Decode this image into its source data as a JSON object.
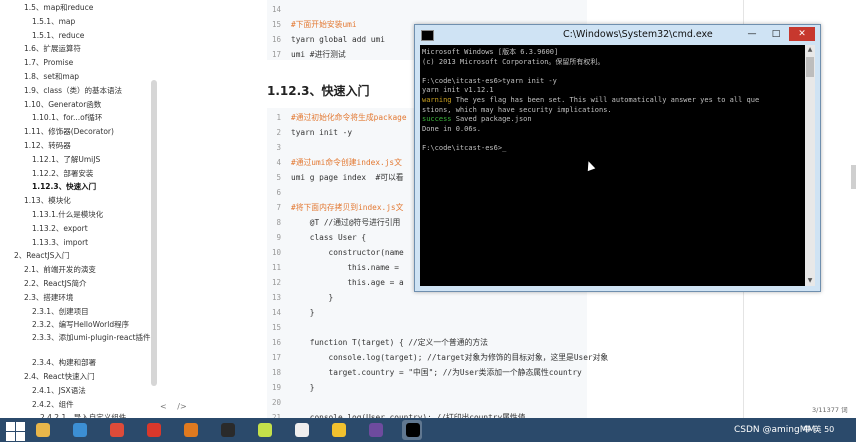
{
  "toc": {
    "items": [
      {
        "label": "1.5、map和reduce",
        "indent": 1
      },
      {
        "label": "1.5.1、map",
        "indent": 2
      },
      {
        "label": "1.5.1、reduce",
        "indent": 2
      },
      {
        "label": "1.6、扩展运算符",
        "indent": 1
      },
      {
        "label": "1.7、Promise",
        "indent": 1
      },
      {
        "label": "1.8、set和map",
        "indent": 1
      },
      {
        "label": "1.9、class（类）的基本语法",
        "indent": 1
      },
      {
        "label": "1.10、Generator函数",
        "indent": 1
      },
      {
        "label": "1.10.1、for...of循环",
        "indent": 2
      },
      {
        "label": "1.11、修饰器(Decorator)",
        "indent": 1
      },
      {
        "label": "1.12、转码器",
        "indent": 1
      },
      {
        "label": "1.12.1、了解UmiJS",
        "indent": 2
      },
      {
        "label": "1.12.2、部署安装",
        "indent": 2
      },
      {
        "label": "1.12.3、快速入门",
        "indent": 2,
        "active": true
      },
      {
        "label": "1.13、模块化",
        "indent": 1
      },
      {
        "label": "1.13.1.什么是模块化",
        "indent": 2
      },
      {
        "label": "1.13.2、export",
        "indent": 2
      },
      {
        "label": "1.13.3、import",
        "indent": 2
      },
      {
        "label": "2、ReactJS入门",
        "indent": 0
      },
      {
        "label": "2.1、前端开发的演变",
        "indent": 1
      },
      {
        "label": "2.2、ReactJS简介",
        "indent": 1
      },
      {
        "label": "2.3、搭建环境",
        "indent": 1
      },
      {
        "label": "2.3.1、创建项目",
        "indent": 2
      },
      {
        "label": "2.3.2、编写HelloWorld程序",
        "indent": 2
      },
      {
        "label": "2.3.3、添加umi-plugin-react插件",
        "indent": 2,
        "wrap": true
      },
      {
        "label": "2.3.4、构建和部署",
        "indent": 2
      },
      {
        "label": "2.4、React快速入门",
        "indent": 1
      },
      {
        "label": "2.4.1、JSX语法",
        "indent": 2
      },
      {
        "label": "2.4.2、组件",
        "indent": 2
      },
      {
        "label": "2.4.2.1、导入自定义组件",
        "indent": 3
      }
    ],
    "bottom_icons": [
      "<",
      "/>"
    ]
  },
  "doc": {
    "heading": "1.12.3、快速入门",
    "block1": [
      {
        "n": "14",
        "text": ""
      },
      {
        "n": "15",
        "text": "#下面开始安装umi",
        "cls": "c"
      },
      {
        "n": "16",
        "text": "tyarn global add umi"
      },
      {
        "n": "17",
        "text": "umi #进行测试",
        "cls": ""
      }
    ],
    "block2": [
      {
        "n": "1",
        "text": "#通过初始化命令将生成package",
        "cls": "c"
      },
      {
        "n": "2",
        "text": "tyarn init -y"
      },
      {
        "n": "3",
        "text": ""
      },
      {
        "n": "4",
        "text": "#通过umi命令创建index.js文",
        "cls": "c"
      },
      {
        "n": "5",
        "text": "umi g page index  #可以看"
      },
      {
        "n": "6",
        "text": ""
      },
      {
        "n": "7",
        "text": "#将下面内存拷贝到index.js文",
        "cls": "c"
      },
      {
        "n": "8",
        "text": "    @T //通过@符号进行引用"
      },
      {
        "n": "9",
        "text": "    class User {"
      },
      {
        "n": "10",
        "text": "        constructor(name"
      },
      {
        "n": "11",
        "text": "            this.name ="
      },
      {
        "n": "12",
        "text": "            this.age = a"
      },
      {
        "n": "13",
        "text": "        }"
      },
      {
        "n": "14",
        "text": "    }"
      },
      {
        "n": "15",
        "text": ""
      },
      {
        "n": "16",
        "text": "    function T(target) { //定义一个普通的方法"
      },
      {
        "n": "17",
        "text": "        console.log(target); //target对象为修饰的目标对象，这里是User对象"
      },
      {
        "n": "18",
        "text": "        target.country = \"中国\"; //为User类添加一个静态属性country"
      },
      {
        "n": "19",
        "text": "    }"
      },
      {
        "n": "20",
        "text": ""
      },
      {
        "n": "21",
        "text": "    console.log(User.country); //打印出country属性值"
      },
      {
        "n": "22",
        "text": ""
      }
    ],
    "page_count": "3/11377 词"
  },
  "cmd": {
    "title": "C:\\Windows\\System32\\cmd.exe",
    "min": "—",
    "max": "□",
    "close": "✕",
    "lines": [
      {
        "text": "Microsoft Windows [版本 6.3.9600]"
      },
      {
        "text": "(c) 2013 Microsoft Corporation。保留所有权利。"
      },
      {
        "text": ""
      },
      {
        "text": "F:\\code\\itcast-es6>tyarn init -y"
      },
      {
        "text": "yarn init v1.12.1"
      },
      {
        "text": "warning The yes flag has been set. This will automatically answer yes to all que",
        "prefix": "warning",
        "cls": "warn"
      },
      {
        "text": "stions, which may have security implications."
      },
      {
        "text": "success Saved package.json",
        "prefix": "success",
        "cls": "succ"
      },
      {
        "text": "Done in 0.06s."
      },
      {
        "text": ""
      },
      {
        "text": "F:\\code\\itcast-es6>_"
      }
    ]
  },
  "taskbar": {
    "watermark": "CSDN @amingMM",
    "tray": "中 英 50",
    "apps": [
      "explorer",
      "browser",
      "chrome",
      "xmind",
      "sublime",
      "idea",
      "sticky",
      "typora",
      "pdf",
      "git",
      "cmd"
    ]
  },
  "colors": {
    "taskbar": "#2b4a6b",
    "cmd_close": "#c7382e",
    "comment": "#e37933"
  }
}
